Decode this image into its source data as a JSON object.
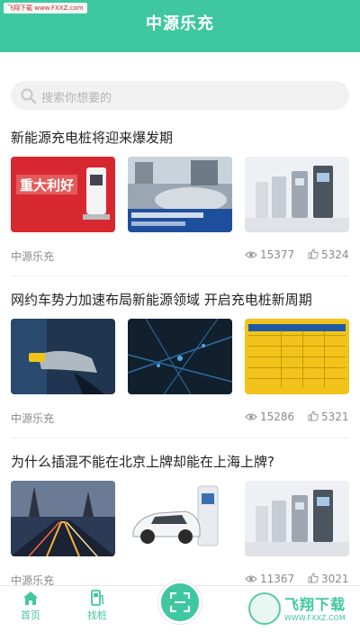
{
  "status_watermark": "飞翔下载 www.FXXZ.com",
  "header": {
    "title": "中源乐充",
    "color": "#3fc7a0"
  },
  "search": {
    "placeholder": "搜索你想要的"
  },
  "articles": [
    {
      "title": "新能源充电桩将迎来爆发期",
      "source": "中源乐充",
      "views": "15377",
      "likes": "5324",
      "thumb_labels": [
        "重大利好",
        "",
        ""
      ]
    },
    {
      "title": "网约车势力加速布局新能源领域 开启充电桩新周期",
      "source": "中源乐充",
      "views": "15286",
      "likes": "5321",
      "thumb_labels": [
        "",
        "",
        ""
      ]
    },
    {
      "title": "为什么插混不能在北京上牌却能在上海上牌?",
      "source": "中源乐充",
      "views": "11367",
      "likes": "3021",
      "thumb_labels": [
        "",
        "",
        ""
      ]
    }
  ],
  "tabbar": {
    "home_label": "首页",
    "find_label": "找桩",
    "scan_icon": "scan-icon"
  },
  "watermark_logo": {
    "title": "飞翔下载",
    "url": "WWW.FXXZ.COM"
  },
  "icons": {
    "search": "search-icon",
    "views": "eye-icon",
    "likes": "thumb-up-icon",
    "home": "home-icon",
    "find": "charger-icon"
  }
}
